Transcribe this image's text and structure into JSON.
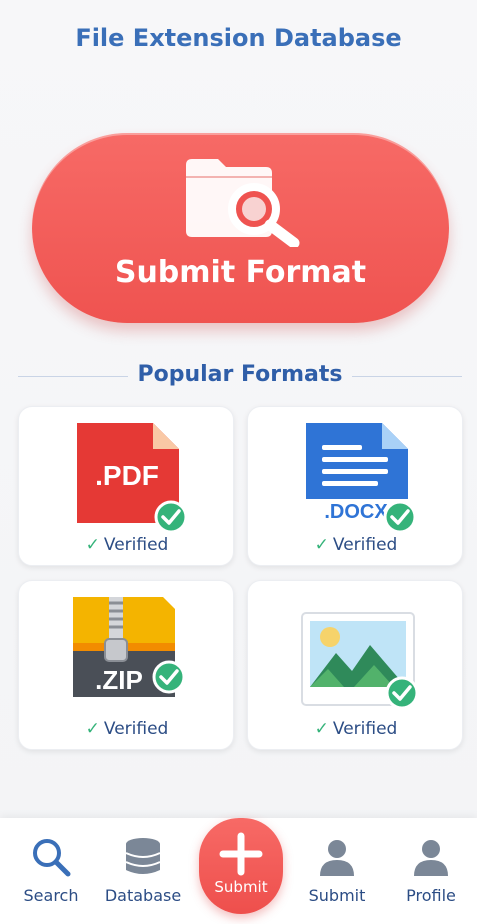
{
  "header": {
    "title": "File Extension Database"
  },
  "cta": {
    "label": "Submit Format",
    "icon": "folder-search-icon",
    "color": "#ef5350"
  },
  "section": {
    "title": "Popular Formats"
  },
  "formats": [
    {
      "ext": ".PDF",
      "status": "Verified",
      "color": "#e53935"
    },
    {
      "ext": ".DOCX",
      "status": "Verified",
      "color": "#2f74d6"
    },
    {
      "ext": ".ZIP",
      "status": "Verified",
      "color": "#f4b400"
    },
    {
      "status": "Verified",
      "icon": "image-file-icon"
    }
  ],
  "nav": {
    "items": [
      {
        "label": "Search",
        "icon": "search-icon"
      },
      {
        "label": "Database",
        "icon": "database-icon"
      },
      {
        "label": "Submit",
        "icon": "plus-icon"
      },
      {
        "label": "Submit",
        "icon": "user-icon"
      },
      {
        "label": "Profile",
        "icon": "user-icon"
      }
    ]
  },
  "colors": {
    "accent": "#ef5350",
    "brand": "#3a6fb8",
    "success": "#35b37a"
  }
}
